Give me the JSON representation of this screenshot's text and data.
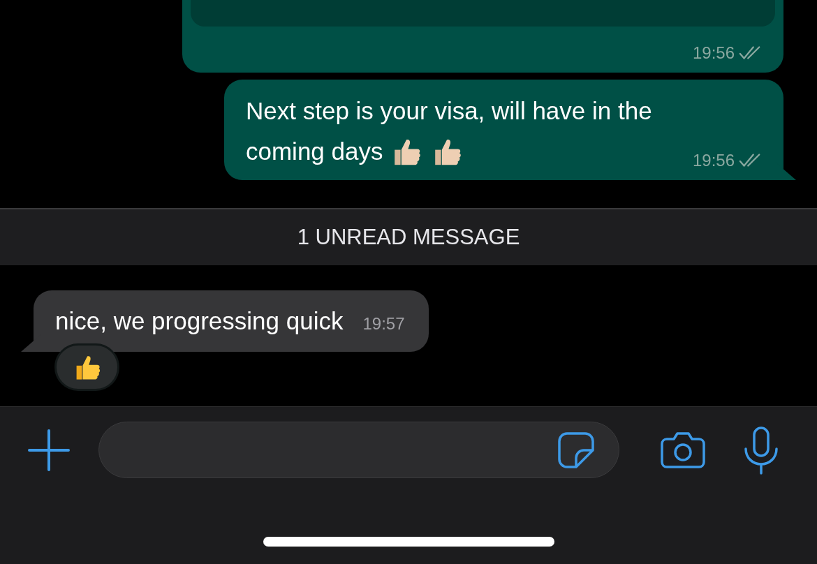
{
  "messages": [
    {
      "kind": "outgoing_quoted",
      "time": "19:56",
      "read": false
    },
    {
      "kind": "outgoing",
      "lines": [
        "Next step is your visa, will have in the",
        "coming days"
      ],
      "emojis": [
        {
          "kind": "thumbs_up"
        },
        {
          "kind": "thumbs_up"
        }
      ],
      "time": "19:56",
      "read": false
    }
  ],
  "unread_banner": "1 UNREAD MESSAGE",
  "incoming": [
    {
      "kind": "incoming",
      "text": "nice, we progressing quick",
      "time": "19:57",
      "reaction": true
    }
  ]
}
